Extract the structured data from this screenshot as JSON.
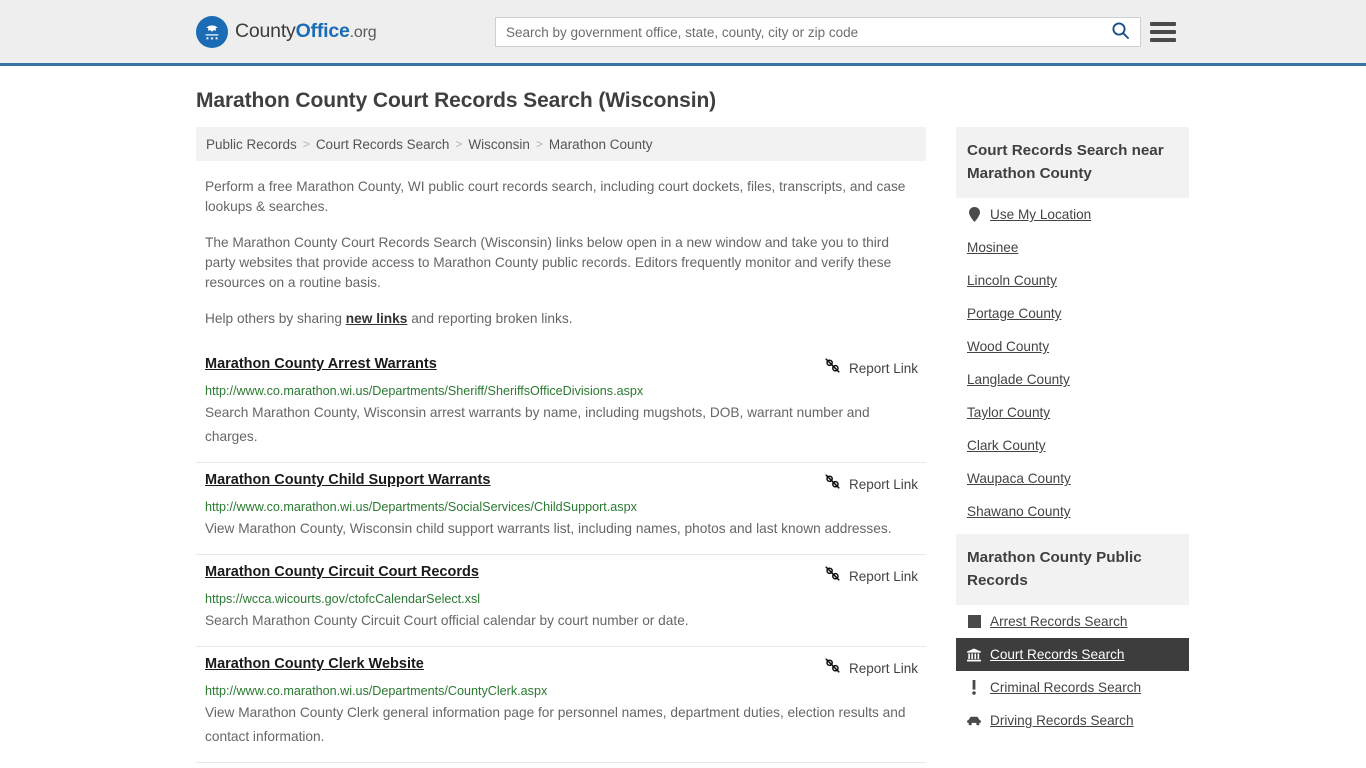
{
  "header": {
    "brand": {
      "part1": "County",
      "part2": "Office",
      "part3": ".org",
      "logo_icon": "eagle-seal-icon"
    },
    "search": {
      "placeholder": "Search by government office, state, county, city or zip code",
      "value": "",
      "search_icon": "search-icon"
    },
    "menu_icon": "hamburger-menu-icon"
  },
  "page": {
    "title": "Marathon County Court Records Search (Wisconsin)"
  },
  "breadcrumb": {
    "items": [
      {
        "label": "Public Records"
      },
      {
        "label": "Court Records Search"
      },
      {
        "label": "Wisconsin"
      },
      {
        "label": "Marathon County"
      }
    ],
    "separator": ">"
  },
  "intro": {
    "paragraph1": "Perform a free Marathon County, WI public court records search, including court dockets, files, transcripts, and case lookups & searches.",
    "paragraph2": "The Marathon County Court Records Search (Wisconsin) links below open in a new window and take you to third party websites that provide access to Marathon County public records. Editors frequently monitor and verify these resources on a routine basis.",
    "paragraph3_before": "Help others by sharing ",
    "paragraph3_link": "new links",
    "paragraph3_after": " and reporting broken links."
  },
  "results": {
    "report_label": "Report Link",
    "report_icon": "broken-link-icon",
    "items": [
      {
        "title": "Marathon County Arrest Warrants",
        "url": "http://www.co.marathon.wi.us/Departments/Sheriff/SheriffsOfficeDivisions.aspx",
        "description": "Search Marathon County, Wisconsin arrest warrants by name, including mugshots, DOB, warrant number and charges."
      },
      {
        "title": "Marathon County Child Support Warrants",
        "url": "http://www.co.marathon.wi.us/Departments/SocialServices/ChildSupport.aspx",
        "description": "View Marathon County, Wisconsin child support warrants list, including names, photos and last known addresses."
      },
      {
        "title": "Marathon County Circuit Court Records",
        "url": "https://wcca.wicourts.gov/ctofcCalendarSelect.xsl",
        "description": "Search Marathon County Circuit Court official calendar by court number or date."
      },
      {
        "title": "Marathon County Clerk Website",
        "url": "http://www.co.marathon.wi.us/Departments/CountyClerk.aspx",
        "description": "View Marathon County Clerk general information page for personnel names, department duties, election results and contact information."
      }
    ]
  },
  "sidebar": {
    "nearby": {
      "heading": "Court Records Search near Marathon County",
      "items": [
        {
          "label": "Use My Location",
          "icon": "map-pin-icon"
        },
        {
          "label": "Mosinee",
          "icon": ""
        },
        {
          "label": "Lincoln County",
          "icon": ""
        },
        {
          "label": "Portage County",
          "icon": ""
        },
        {
          "label": "Wood County",
          "icon": ""
        },
        {
          "label": "Langlade County",
          "icon": ""
        },
        {
          "label": "Taylor County",
          "icon": ""
        },
        {
          "label": "Clark County",
          "icon": ""
        },
        {
          "label": "Waupaca County",
          "icon": ""
        },
        {
          "label": "Shawano County",
          "icon": ""
        }
      ]
    },
    "public_records": {
      "heading": "Marathon County Public Records",
      "items": [
        {
          "label": "Arrest Records Search",
          "icon": "square-icon",
          "active": false
        },
        {
          "label": "Court Records Search",
          "icon": "courthouse-icon",
          "active": true
        },
        {
          "label": "Criminal Records Search",
          "icon": "exclamation-icon",
          "active": false
        },
        {
          "label": "Driving Records Search",
          "icon": "car-icon",
          "active": false
        }
      ]
    }
  },
  "colors": {
    "brand_blue": "#1b6cb5",
    "header_border": "#3a72a5",
    "url_green": "#2a7a31",
    "active_bg": "#3d3d3d",
    "panel_bg": "#f2f2f2"
  }
}
